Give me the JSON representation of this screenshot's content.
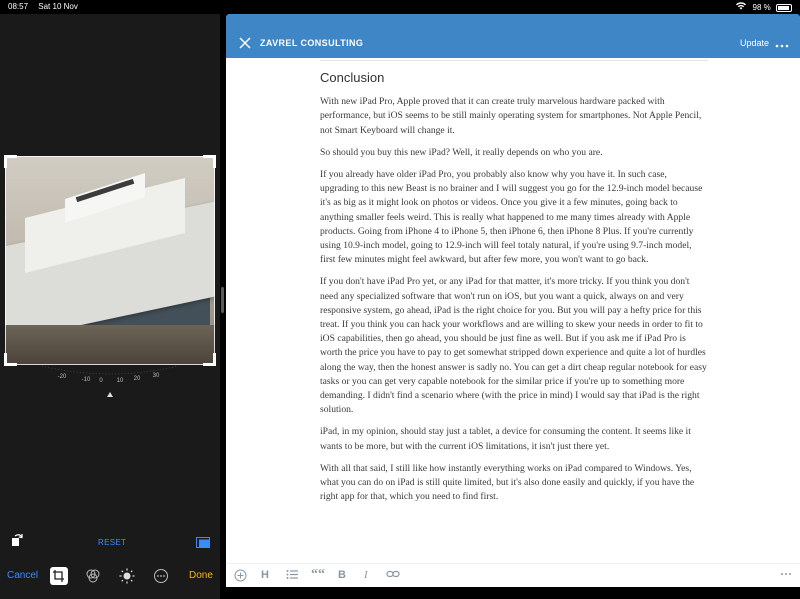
{
  "status_bar": {
    "time": "08:57",
    "date": "Sat 10 Nov",
    "battery": "98 %"
  },
  "editor": {
    "reset_label": "RESET",
    "cancel_label": "Cancel",
    "done_label": "Done",
    "dial_ticks": [
      "-20",
      "-10",
      "0",
      "10",
      "20",
      "30"
    ]
  },
  "header": {
    "brand": "ZAVREL CONSULTING",
    "update_label": "Update"
  },
  "article": {
    "heading": "Conclusion",
    "paragraphs": [
      "With new iPad Pro, Apple proved that it can create truly marvelous hardware packed with performance, but iOS seems to be still mainly operating system for smartphones. Not Apple Pencil, not Smart Keyboard will change it.",
      "So should you buy this new iPad? Well, it really depends on who you are.",
      "If you already have older iPad Pro, you probably also know why you have it. In such case, upgrading to this new Beast is no brainer and I will suggest you go for the 12.9-inch model because it's as big as it might look on photos or videos. Once you give it a few minutes, going back to anything smaller feels weird. This is really what happened to me many times already with Apple products. Going from iPhone 4 to iPhone 5, then iPhone 6, then iPhone 8 Plus. If you're currently using 10.9-inch model, going to 12.9-inch will feel totaly natural, if you're using 9.7-inch model, first few minutes might feel awkward, but after few more, you won't want to go back.",
      "If you don't have iPad Pro yet, or any iPad for that matter, it's more tricky. If you think you don't need any specialized software that won't run on iOS, but you want a quick, always on and very responsive system, go ahead, iPad is the right choice for you. But you will pay a hefty price for this treat. If you think you can hack your workflows and are willing to skew your needs in order to fit to iOS capabilities, then go ahead, you should be just fine as well. But if you ask me if iPad Pro is worth the price you have to pay to get somewhat stripped down experience and quite a lot of hurdles along the way, then the honest answer is sadly no. You can get a dirt cheap regular notebook for easy tasks or you can get very capable notebook for the similar price if you're up to something more demanding. I didn't find a scenario where (with the price in mind) I would say that iPad is the right solution.",
      "iPad, in my opinion, should stay just a tablet, a device for consuming the content. It seems like it wants to be more, but with the current iOS limitations, it isn't just there yet.",
      "With all that said, I still like how instantly everything works on iPad compared to Windows. Yes, what you can do on iPad is still quite limited, but it's also done easily and quickly, if you have the right app for that, which you need to find first."
    ]
  },
  "format_bar": {
    "heading_label": "H",
    "quote_label": "““",
    "bold_label": "B",
    "italic_label": "I"
  },
  "colors": {
    "header_blue": "#3e86c6",
    "ios_blue": "#3a8bff",
    "done_yellow": "#f4b619"
  }
}
